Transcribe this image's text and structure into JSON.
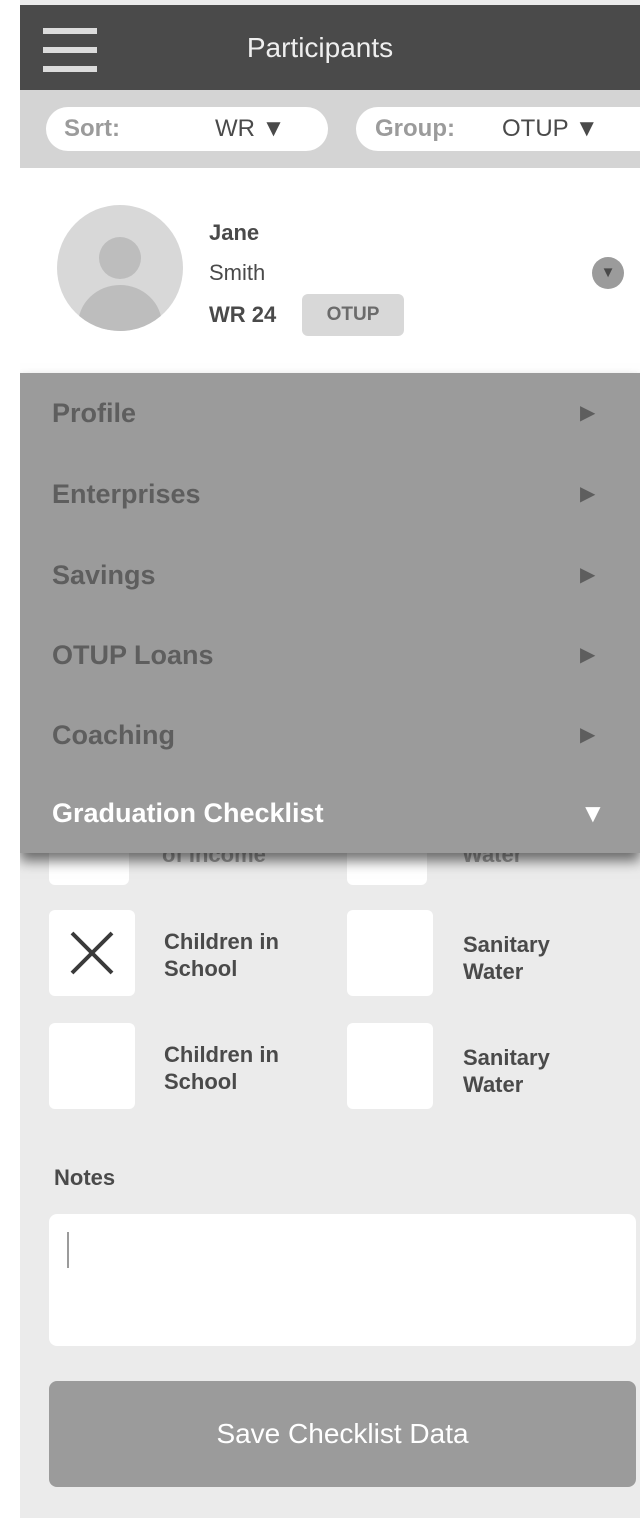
{
  "header": {
    "title": "Participants",
    "menu_icon": "hamburger-icon"
  },
  "sortbar": {
    "sort_label": "Sort:",
    "sort_value": "WR ▼",
    "group_label": "Group:",
    "group_value": "OTUP ▼"
  },
  "participant": {
    "first_name": "Jane",
    "last_name": "Smith",
    "wr": "WR 24",
    "group_badge": "OTUP",
    "expand_icon": "▼"
  },
  "menu": {
    "items": [
      {
        "label": "Profile",
        "arrow": "▶"
      },
      {
        "label": "Enterprises",
        "arrow": "▶"
      },
      {
        "label": "Savings",
        "arrow": "▶"
      },
      {
        "label": "OTUP Loans",
        "arrow": "▶"
      },
      {
        "label": "Coaching",
        "arrow": "▶"
      },
      {
        "label": "Graduation Checklist",
        "arrow": "▼"
      }
    ]
  },
  "checklist": {
    "peek_left": "of Income",
    "peek_right": "Water",
    "rows": [
      {
        "left": {
          "label": "Children in School",
          "mark": "✕"
        },
        "right": {
          "label": "Sanitary Water",
          "mark": ""
        }
      },
      {
        "left": {
          "label": "Children in School",
          "mark": ""
        },
        "right": {
          "label": "Sanitary Water",
          "mark": ""
        }
      }
    ]
  },
  "notes": {
    "label": "Notes",
    "value": ""
  },
  "save_button": {
    "label": "Save Checklist Data"
  },
  "colors": {
    "header_bg": "#4a4a4a",
    "menu_bg": "#9b9b9b",
    "panel_bg": "#ebebeb",
    "accent_gray": "#9b9b9b"
  }
}
